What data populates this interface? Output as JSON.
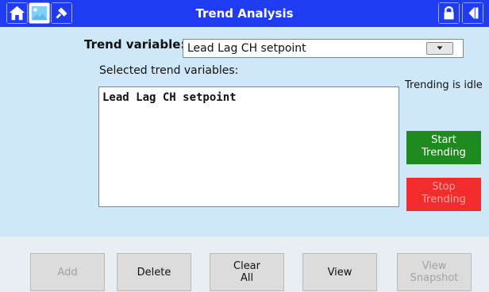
{
  "header": {
    "title": "Trend Analysis",
    "icons": {
      "home": "home-icon",
      "image": "picture-icon",
      "pin": "pin-icon",
      "lock": "lock-icon",
      "back": "back-icon"
    }
  },
  "form": {
    "trend_variable_label": "Trend variable:",
    "trend_variable_value": "Lead Lag CH setpoint",
    "selected_label": "Selected trend variables:",
    "selected_items": [
      "Lead Lag CH setpoint"
    ]
  },
  "status": {
    "text": "Trending is idle"
  },
  "side_buttons": {
    "start": "Start\nTrending",
    "stop": "Stop\nTrending"
  },
  "bottom_buttons": {
    "add": "Add",
    "delete": "Delete",
    "clear_all": "Clear\nAll",
    "view": "View",
    "view_snapshot": "View\nSnapshot"
  },
  "colors": {
    "header_bg": "#1f3cf3",
    "start_bg": "#1f8a1f",
    "stop_bg": "#f22b2b",
    "page_bg": "#cfe8f9"
  }
}
